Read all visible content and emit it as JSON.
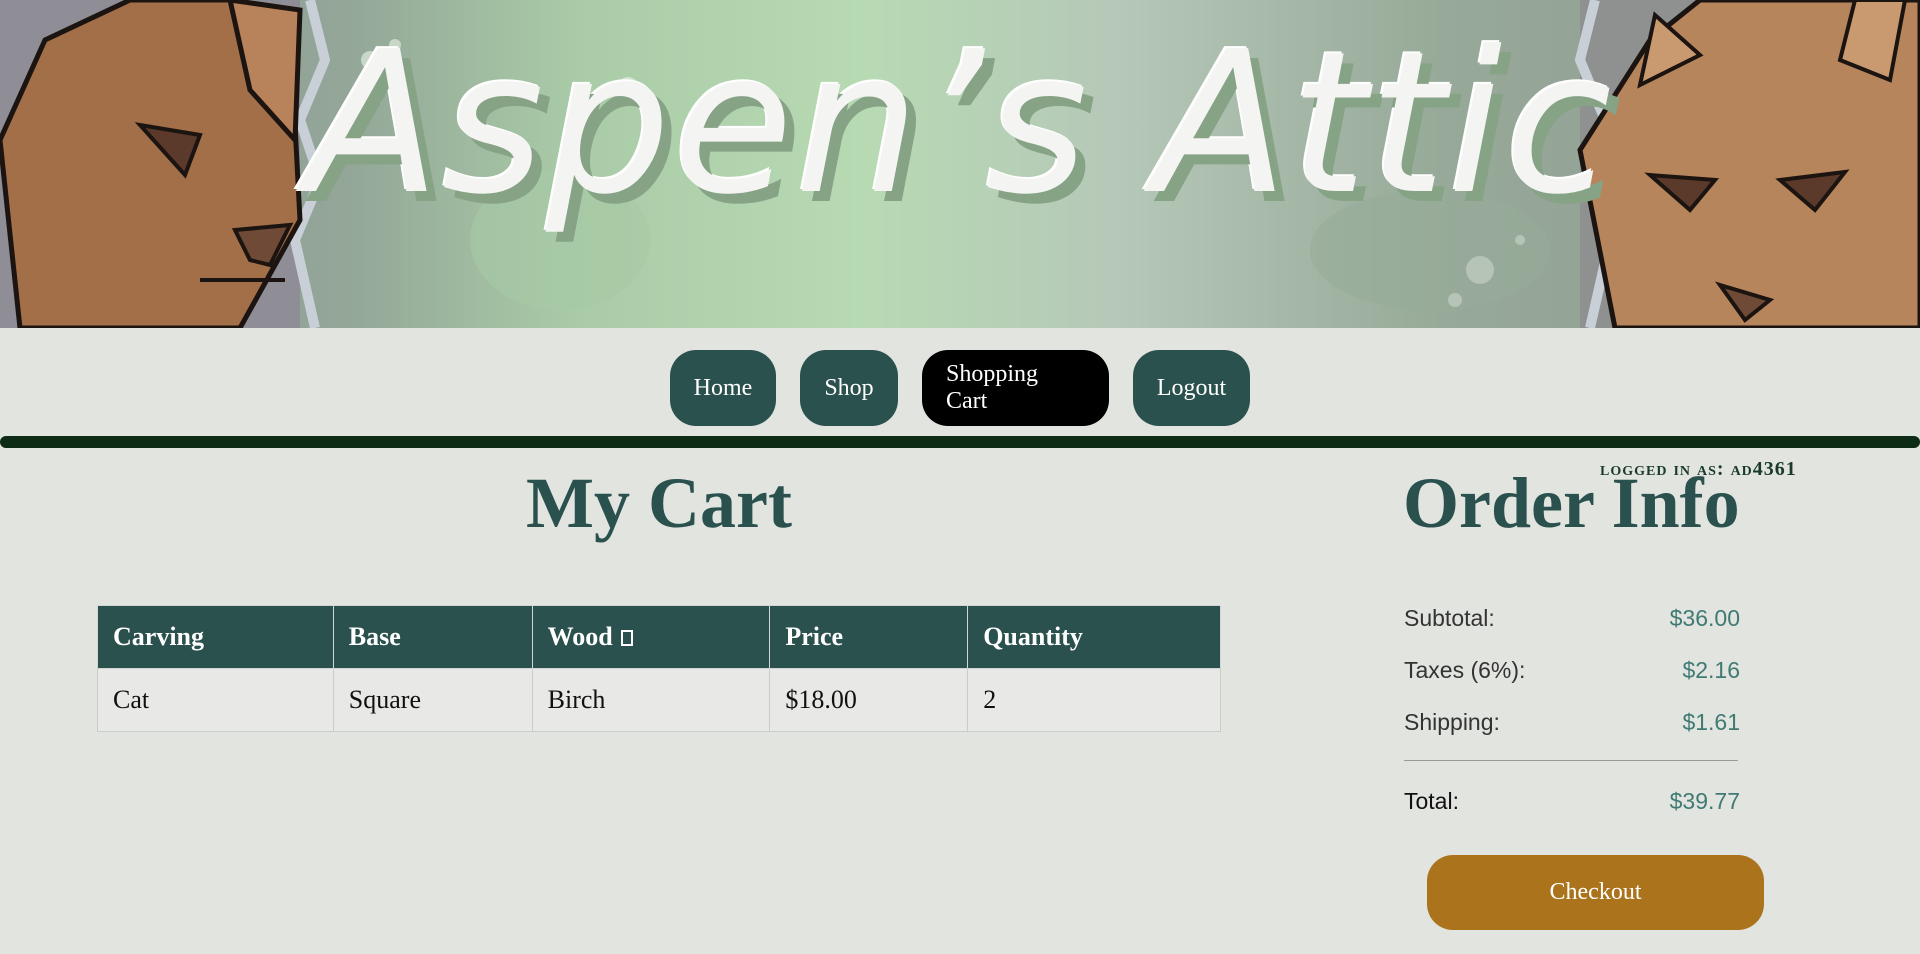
{
  "banner": {
    "title": "Aspen’s Attic"
  },
  "nav": {
    "home": "Home",
    "shop": "Shop",
    "cart": "Shopping Cart",
    "logout": "Logout",
    "active": "Shopping Cart"
  },
  "user": {
    "logged_in_text": "logged in as: ad4361"
  },
  "cart": {
    "title": "My Cart",
    "columns": [
      "Carving",
      "Base",
      "Wood",
      "Price",
      "Quantity"
    ],
    "rows": [
      [
        "Cat",
        "Square",
        "Birch",
        "$18.00",
        "2"
      ]
    ],
    "sort_icon": "sort-indicator-icon"
  },
  "order": {
    "title": "Order Info",
    "subtotal_label": "Subtotal:",
    "subtotal_value": "$36.00",
    "taxes_label": "Taxes (6%):",
    "taxes_value": "$2.16",
    "shipping_label": "Shipping:",
    "shipping_value": "$1.61",
    "total_label": "Total:",
    "total_value": "$39.77",
    "checkout_label": "Checkout"
  },
  "colors": {
    "primary": "#2a514d",
    "active_nav": "#000000",
    "checkout": "#ab731b",
    "divider": "#0e2c15",
    "page_bg": "#e2e4e0"
  }
}
